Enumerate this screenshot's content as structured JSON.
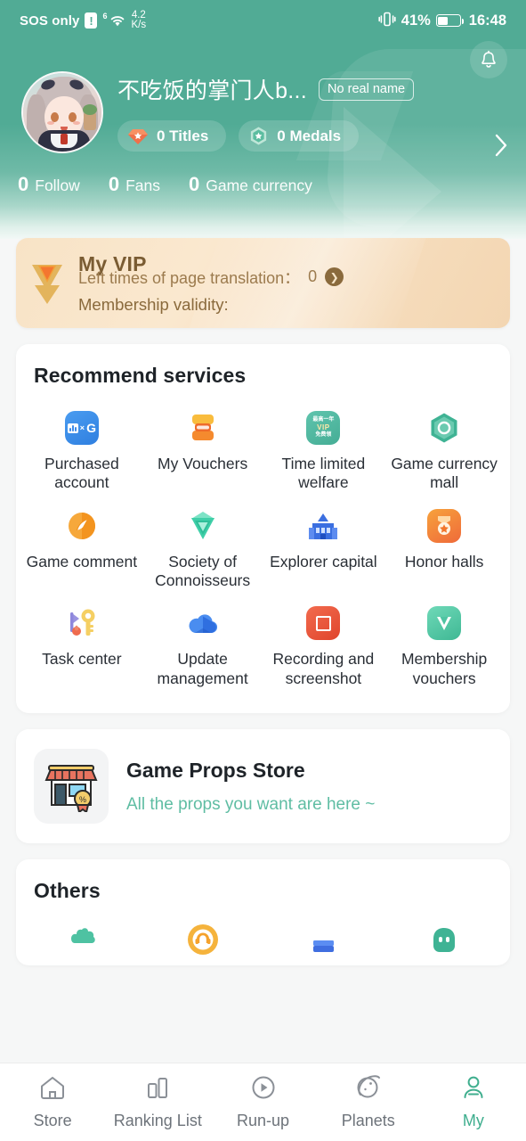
{
  "status_bar": {
    "carrier": "SOS only",
    "alert_icon": "!",
    "signal_sup": "6",
    "wifi_icon": "wifi-icon",
    "net_speed_value": "4.2",
    "net_speed_unit": "K/s",
    "vibrate_icon": "vibrate-icon",
    "battery_percent": "41%",
    "time": "16:48"
  },
  "header": {
    "bell_icon": "bell-icon",
    "username": "不吃饭的掌门人b...",
    "realname_tag": "No real name",
    "titles_label": "0 Titles",
    "medals_label": "0 Medals",
    "chevron_icon": "chevron-right-icon",
    "stats": [
      {
        "value": "0",
        "label": "Follow"
      },
      {
        "value": "0",
        "label": "Fans"
      },
      {
        "value": "0",
        "label": "Game currency"
      }
    ],
    "accent_color": "#51ab95"
  },
  "vip": {
    "icon": "vip-v-icon",
    "title": "My VIP",
    "validity_label": "Membership validity:",
    "left_times_label": "Left times of page translation：",
    "left_times_value": "0",
    "chevron_icon": "chevron-right-circle-icon",
    "bg_color": "#f8e3c6",
    "text_color": "#7a5c33"
  },
  "recommend": {
    "title": "Recommend services",
    "items": [
      {
        "label": "Purchased account",
        "icon": "purchased-account-icon"
      },
      {
        "label": "My Vouchers",
        "icon": "vouchers-icon"
      },
      {
        "label": "Time limited welfare",
        "icon": "time-limited-welfare-icon",
        "icon_text_top": "最高一年",
        "icon_text_mid": "VIP",
        "icon_text_bottom": "免费领"
      },
      {
        "label": "Game currency mall",
        "icon": "game-currency-mall-icon"
      },
      {
        "label": "Game comment",
        "icon": "game-comment-icon"
      },
      {
        "label": "Society of Connoisseurs",
        "icon": "society-connoisseurs-icon"
      },
      {
        "label": "Explorer capital",
        "icon": "explorer-capital-icon"
      },
      {
        "label": "Honor halls",
        "icon": "honor-halls-icon"
      },
      {
        "label": "Task center",
        "icon": "task-center-icon"
      },
      {
        "label": "Update management",
        "icon": "update-management-icon"
      },
      {
        "label": "Recording and screenshot",
        "icon": "recording-screenshot-icon"
      },
      {
        "label": "Membership vouchers",
        "icon": "membership-vouchers-icon"
      }
    ]
  },
  "props_store": {
    "icon": "shop-front-icon",
    "title": "Game Props Store",
    "subtitle": "All the props you want are here ~",
    "subtitle_color": "#5fbda3"
  },
  "others": {
    "title": "Others",
    "items": [
      {
        "icon": "puzzle-icon"
      },
      {
        "icon": "headset-support-icon"
      },
      {
        "icon": "book-card-icon"
      },
      {
        "icon": "robot-assistant-icon"
      }
    ]
  },
  "tabbar": {
    "active_color": "#3fae8e",
    "items": [
      {
        "label": "Store",
        "icon": "home-icon",
        "active": false
      },
      {
        "label": "Ranking List",
        "icon": "chart-icon",
        "active": false
      },
      {
        "label": "Run-up",
        "icon": "play-icon",
        "active": false
      },
      {
        "label": "Planets",
        "icon": "planet-icon",
        "active": false
      },
      {
        "label": "My",
        "icon": "person-icon",
        "active": true
      }
    ]
  }
}
